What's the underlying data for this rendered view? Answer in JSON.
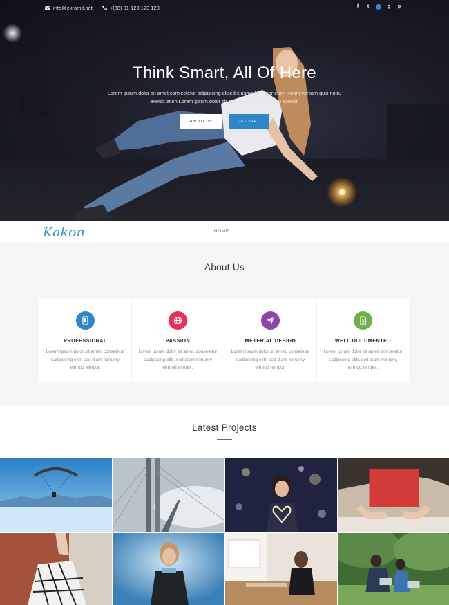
{
  "topbar": {
    "email": "info@ekramit.net",
    "phone": "+(88) 01 123 123 123",
    "social_icons": [
      "facebook-icon",
      "twitter-icon",
      "linkedin-icon",
      "google-plus-icon",
      "pinterest-icon"
    ],
    "social_glyphs": [
      "f",
      "t",
      "",
      "g",
      "p"
    ]
  },
  "hero": {
    "title": "Think Smart, All Of Here",
    "text": "Lorem ipsum dolor sit amet consectetur adipisicing elised eiusmod tempor enim minim veniam quis notru exercit ation Lorem ipsum dolor sit amet.Veniam quis notru exercit.",
    "button_about": "ABOUT US",
    "button_start": "GET STRT"
  },
  "nav": {
    "logo": "Kakon",
    "home": "HOME"
  },
  "about": {
    "title": "About Us",
    "cards": [
      {
        "title": "PROFESSIONAL",
        "text": "Lorem ipsum dolor sit amet, consetetur sadipscing elitr, sed diam nonumy eirmod tempor.",
        "icon": "tablet-icon",
        "color": "#2f87c8"
      },
      {
        "title": "PASSION",
        "text": "Lorem ipsum dolor sit amet, consetetur sadipscing elitr, sed diam nonumy eirmod tempor.",
        "icon": "globe-icon",
        "color": "#ea2d5c"
      },
      {
        "title": "METERIAL DESIGN",
        "text": "Lorem ipsum dolor sit amet, consetetur sadipscing elitr, sed diam nonumy eirmod tempor.",
        "icon": "paper-plane-icon",
        "color": "#8e44ad"
      },
      {
        "title": "WELL DOCUMENTED",
        "text": "Lorem ipsum dolor sit amet, consetetur sadipscing elitr, sed diam nonumy eirmod tempor.",
        "icon": "document-icon",
        "color": "#6ab04c"
      }
    ]
  },
  "projects": {
    "title": "Latest Projects",
    "tiles": [
      "paraglider-photo",
      "bridge-photo",
      "heart-lights-photo",
      "reading-book-photo",
      "bag-photo",
      "woman-smoke-photo",
      "cafe-photo",
      "couple-park-photo"
    ]
  },
  "colors": {
    "accent": "#2f87c8",
    "hero_bg": "#1c1d29"
  }
}
